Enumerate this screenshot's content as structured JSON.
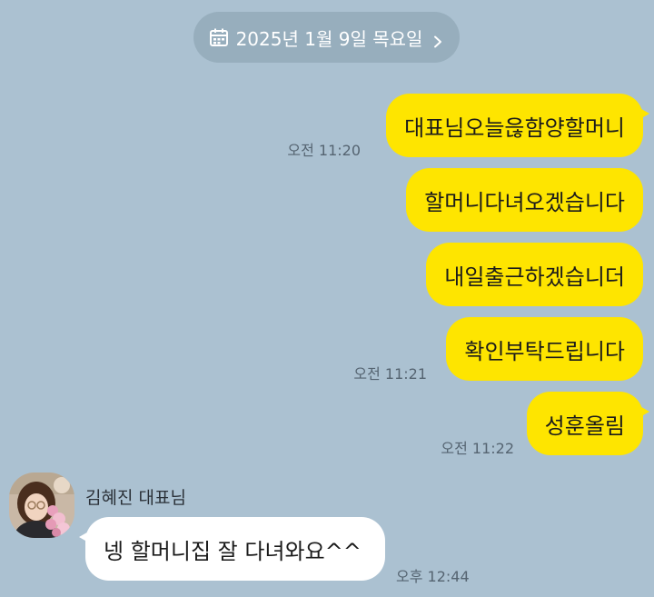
{
  "date_divider": {
    "label": "2025년 1월 9일 목요일",
    "icon": "calendar-icon",
    "chevron": "chevron-right-icon"
  },
  "messages_out": [
    {
      "text": "대표님오늘읂함양할머니",
      "time": "오전 11:20"
    },
    {
      "text": "할머니다녀오겠습니다",
      "time": ""
    },
    {
      "text": "내일출근하겠습니더",
      "time": ""
    },
    {
      "text": "확인부탁드립니다",
      "time": "오전 11:21"
    },
    {
      "text": "성훈올림",
      "time": "오전 11:22"
    }
  ],
  "messages_in": [
    {
      "sender": "김혜진 대표님",
      "text": "넹 할머니집 잘 다녀와요^^",
      "time": "오후 12:44"
    }
  ],
  "colors": {
    "background": "#abc1d1",
    "outgoing_bubble": "#fee500",
    "incoming_bubble": "#ffffff",
    "date_pill": "#97aebd"
  }
}
